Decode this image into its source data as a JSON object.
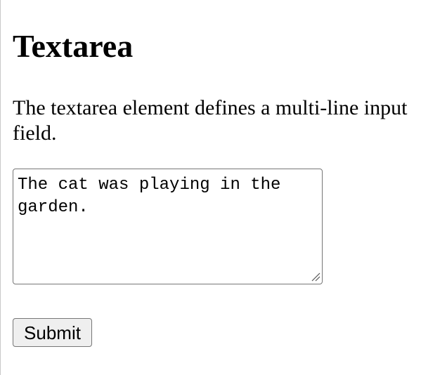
{
  "page": {
    "heading": "Textarea",
    "description": "The textarea element defines a multi-line input field."
  },
  "form": {
    "textarea_value": "The cat was playing in the garden.",
    "submit_label": "Submit"
  }
}
